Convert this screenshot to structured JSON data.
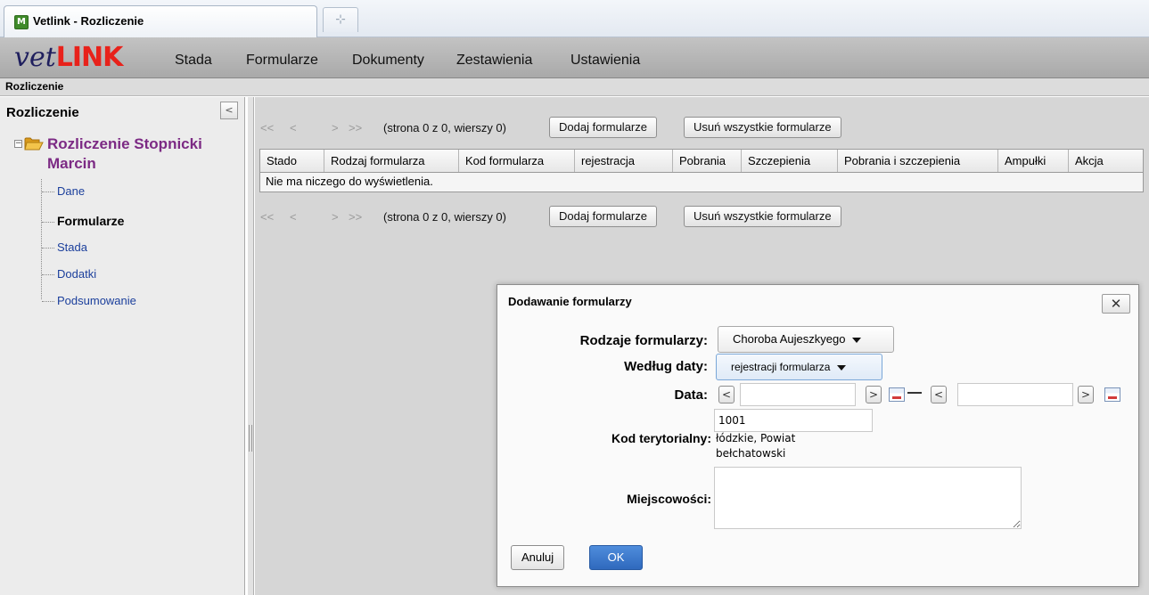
{
  "browser": {
    "tab_title": "Vetlink - Rozliczenie",
    "favicon_glyph": "M",
    "new_tab_glyph": "⊹"
  },
  "app": {
    "logo_prefix": "vet",
    "logo_suffix": "LINK",
    "nav": [
      "Stada",
      "Formularze",
      "Dokumenty",
      "Zestawienia",
      "Ustawienia"
    ],
    "breadcrumb": "Rozliczenie"
  },
  "sidebar": {
    "title": "Rozliczenie",
    "collapse_glyph": "<",
    "root": "Rozliczenie Stopnicki Marcin",
    "items": [
      {
        "label": "Dane",
        "active": false
      },
      {
        "label": "Formularze",
        "active": true
      },
      {
        "label": "Stada",
        "active": false
      },
      {
        "label": "Dodatki",
        "active": false
      },
      {
        "label": "Podsumowanie",
        "active": false
      }
    ]
  },
  "pager": {
    "first": "<<",
    "prev": "<",
    "next": ">",
    "last": ">>",
    "info": "(strona 0 z 0, wierszy 0)",
    "add_button": "Dodaj formularze",
    "remove_all_button": "Usuń wszystkie formularze"
  },
  "grid": {
    "columns": [
      "Stado",
      "Rodzaj formularza",
      "Kod formularza",
      "rejestracja",
      "Pobrania",
      "Szczepienia",
      "Pobrania i szczepienia",
      "Ampułki",
      "Akcja"
    ],
    "empty_text": "Nie ma niczego do wyświetlenia."
  },
  "dialog": {
    "title": "Dodawanie formularzy",
    "close_glyph": "✕",
    "form_types_label": "Rodzaje formularzy:",
    "form_types_value": "Choroba Aujeszkyego",
    "by_date_label": "Według daty:",
    "by_date_value": "rejestracji formularza",
    "date_label": "Data:",
    "date_from_value": "",
    "date_to_value": "",
    "prev_glyph": "<",
    "next_glyph": ">",
    "territory_label": "Kod terytorialny:",
    "territory_code": "1001",
    "territory_line1": "łódzkie, Powiat",
    "territory_line2": "bełchatowski",
    "places_label": "Miejscowości:",
    "places_value": "",
    "cancel_button": "Anuluj",
    "ok_button": "OK"
  }
}
